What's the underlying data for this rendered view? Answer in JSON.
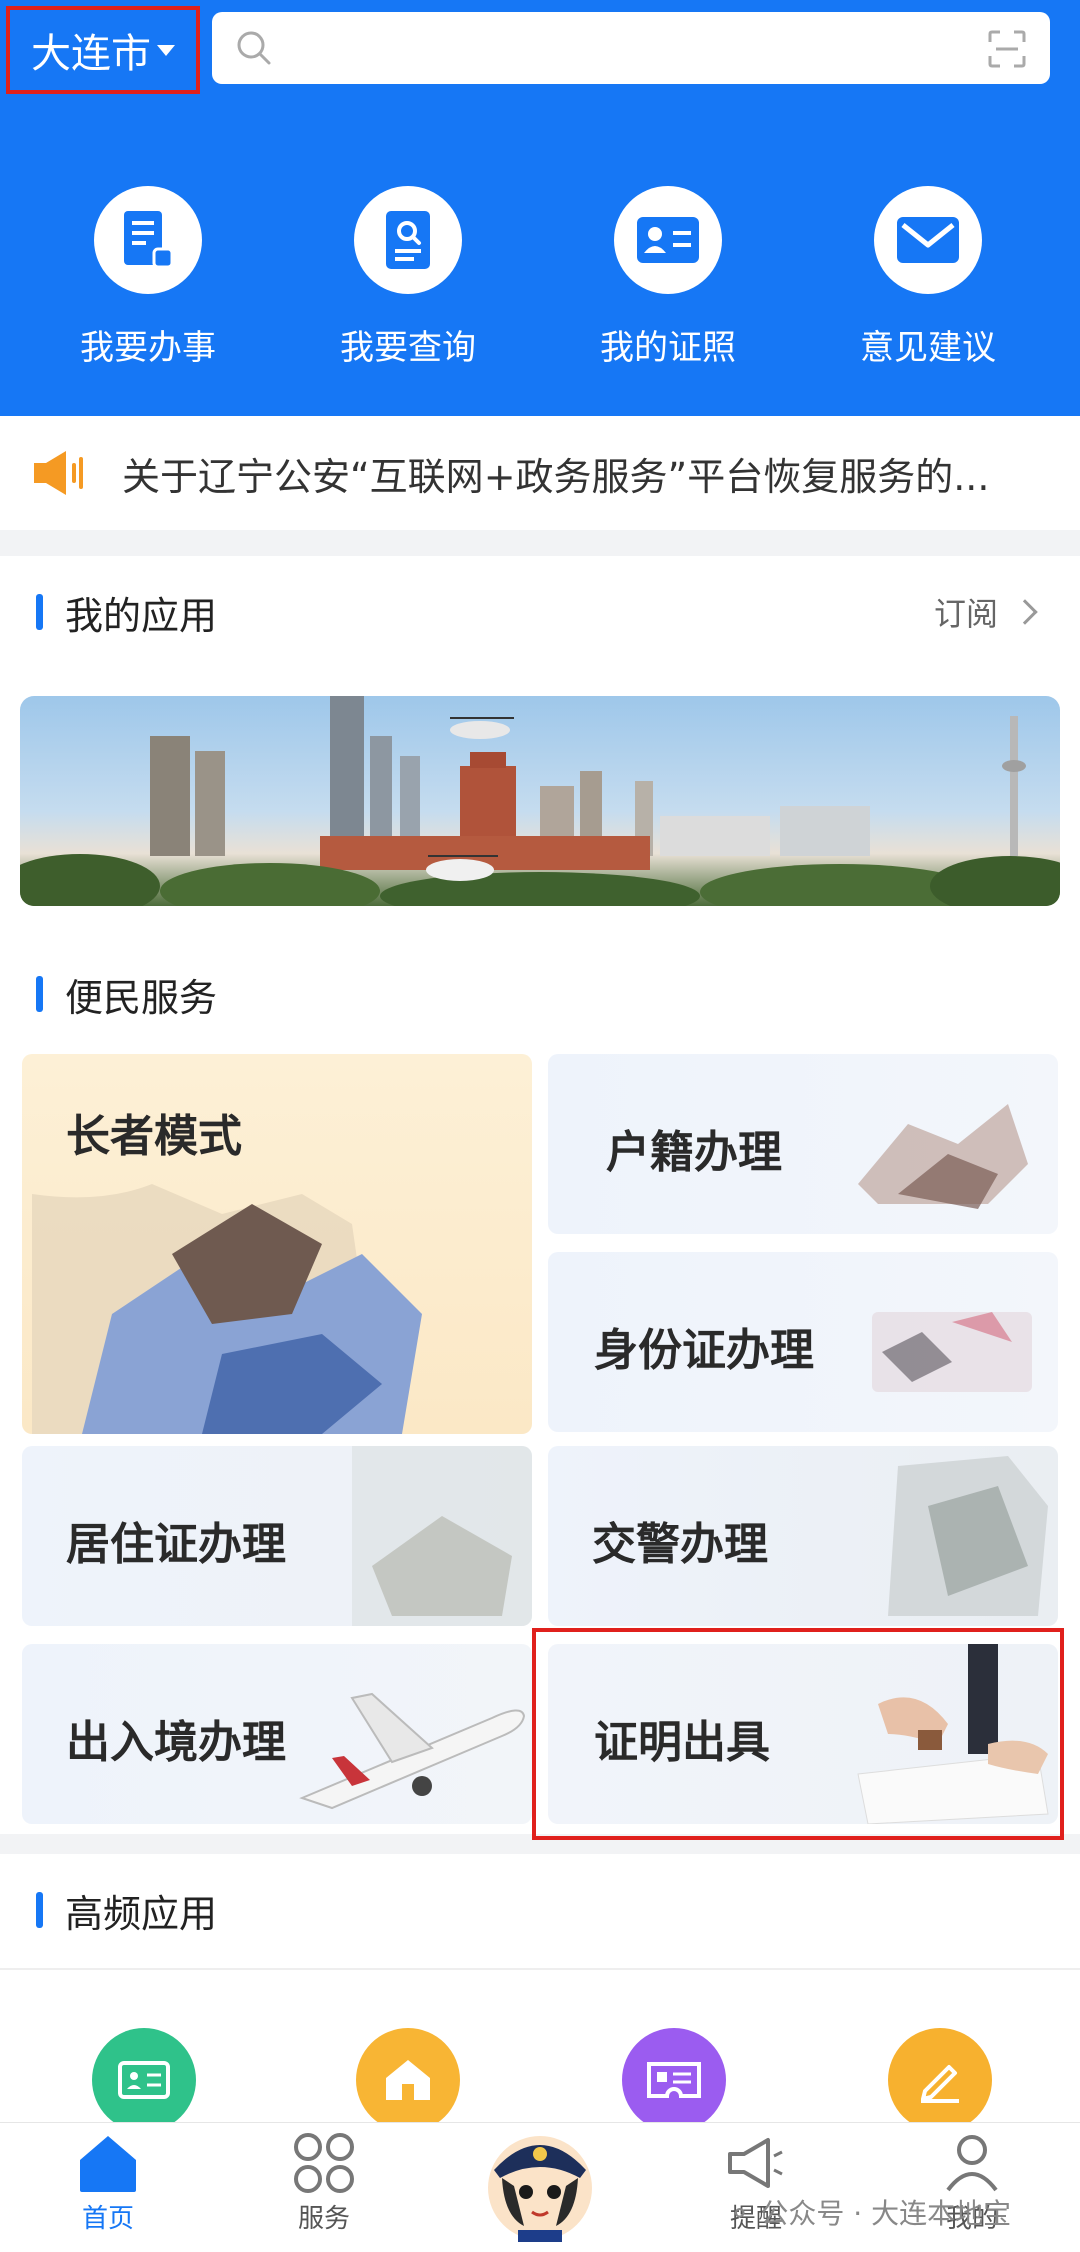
{
  "header": {
    "city": "大连市",
    "search_placeholder": "",
    "quick_actions": [
      {
        "label": "我要办事",
        "icon": "document-icon"
      },
      {
        "label": "我要查询",
        "icon": "search-document-icon"
      },
      {
        "label": "我的证照",
        "icon": "id-card-icon"
      },
      {
        "label": "意见建议",
        "icon": "envelope-icon"
      }
    ]
  },
  "notice": {
    "text": "关于辽宁公安“互联网+政务服务”平台恢复服务的..."
  },
  "my_apps": {
    "title": "我的应用",
    "subscribe_label": "订阅"
  },
  "convenience": {
    "title": "便民服务",
    "cards": [
      {
        "label": "长者模式"
      },
      {
        "label": "户籍办理"
      },
      {
        "label": "身份证办理"
      },
      {
        "label": "居住证办理"
      },
      {
        "label": "交警办理"
      },
      {
        "label": "出入境办理"
      },
      {
        "label": "证明出具"
      }
    ]
  },
  "high_frequency": {
    "title": "高频应用",
    "icons": [
      {
        "icon": "id-card-icon",
        "color": "#2fc28a"
      },
      {
        "icon": "house-icon",
        "color": "#f8b534"
      },
      {
        "icon": "ticket-icon",
        "color": "#9b5cf0"
      },
      {
        "icon": "pencil-icon",
        "color": "#f7b12f"
      }
    ]
  },
  "tabbar": {
    "tabs": [
      {
        "label": "首页",
        "active": true
      },
      {
        "label": "服务",
        "active": false
      },
      {
        "label": "提醒",
        "active": false
      },
      {
        "label": "我的",
        "active": false
      }
    ]
  },
  "watermark": "公众号 · 大连本地宝",
  "colors": {
    "primary": "#1677f5",
    "highlight_border": "#e0201c"
  }
}
